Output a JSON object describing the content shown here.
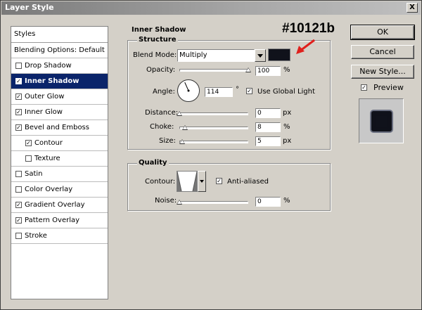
{
  "window": {
    "title": "Layer Style",
    "close_glyph": "X"
  },
  "styles_list": {
    "header": "Styles",
    "items": [
      {
        "label": "Blending Options: Default",
        "checkbox": false,
        "checked": false,
        "selected": false,
        "sub": false
      },
      {
        "label": "Drop Shadow",
        "checkbox": true,
        "checked": false,
        "selected": false,
        "sub": false
      },
      {
        "label": "Inner Shadow",
        "checkbox": true,
        "checked": true,
        "selected": true,
        "sub": false
      },
      {
        "label": "Outer Glow",
        "checkbox": true,
        "checked": true,
        "selected": false,
        "sub": false
      },
      {
        "label": "Inner Glow",
        "checkbox": true,
        "checked": true,
        "selected": false,
        "sub": false
      },
      {
        "label": "Bevel and Emboss",
        "checkbox": true,
        "checked": true,
        "selected": false,
        "sub": false
      },
      {
        "label": "Contour",
        "checkbox": true,
        "checked": true,
        "selected": false,
        "sub": true
      },
      {
        "label": "Texture",
        "checkbox": true,
        "checked": false,
        "selected": false,
        "sub": true
      },
      {
        "label": "Satin",
        "checkbox": true,
        "checked": false,
        "selected": false,
        "sub": false
      },
      {
        "label": "Color Overlay",
        "checkbox": true,
        "checked": false,
        "selected": false,
        "sub": false
      },
      {
        "label": "Gradient Overlay",
        "checkbox": true,
        "checked": true,
        "selected": false,
        "sub": false
      },
      {
        "label": "Pattern Overlay",
        "checkbox": true,
        "checked": true,
        "selected": false,
        "sub": false
      },
      {
        "label": "Stroke",
        "checkbox": true,
        "checked": false,
        "selected": false,
        "sub": false
      }
    ]
  },
  "inner_shadow": {
    "title": "Inner Shadow",
    "structure": {
      "title": "Structure",
      "blend_mode_label": "Blend Mode:",
      "blend_mode_value": "Multiply",
      "color": "#10121b",
      "opacity_label": "Opacity:",
      "opacity_value": "100",
      "opacity_level": 1.0,
      "opacity_unit": "%",
      "angle_label": "Angle:",
      "angle_value": "114",
      "angle_unit": "°",
      "use_global_light_label": "Use Global Light",
      "use_global_light_checked": true,
      "distance_label": "Distance:",
      "distance_value": "0",
      "distance_level": 0.0,
      "distance_unit": "px",
      "choke_label": "Choke:",
      "choke_value": "8",
      "choke_level": 0.08,
      "choke_unit": "%",
      "size_label": "Size:",
      "size_value": "5",
      "size_level": 0.04,
      "size_unit": "px"
    },
    "quality": {
      "title": "Quality",
      "contour_label": "Contour:",
      "anti_aliased_label": "Anti-aliased",
      "anti_aliased_checked": true,
      "noise_label": "Noise:",
      "noise_value": "0",
      "noise_level": 0.0,
      "noise_unit": "%"
    }
  },
  "annotation": {
    "text": "#10121b",
    "arrow_color": "#e0201c"
  },
  "buttons": {
    "ok": "OK",
    "cancel": "Cancel",
    "new_style": "New Style..."
  },
  "preview": {
    "label": "Preview",
    "checked": true
  },
  "check_glyph": "✓"
}
